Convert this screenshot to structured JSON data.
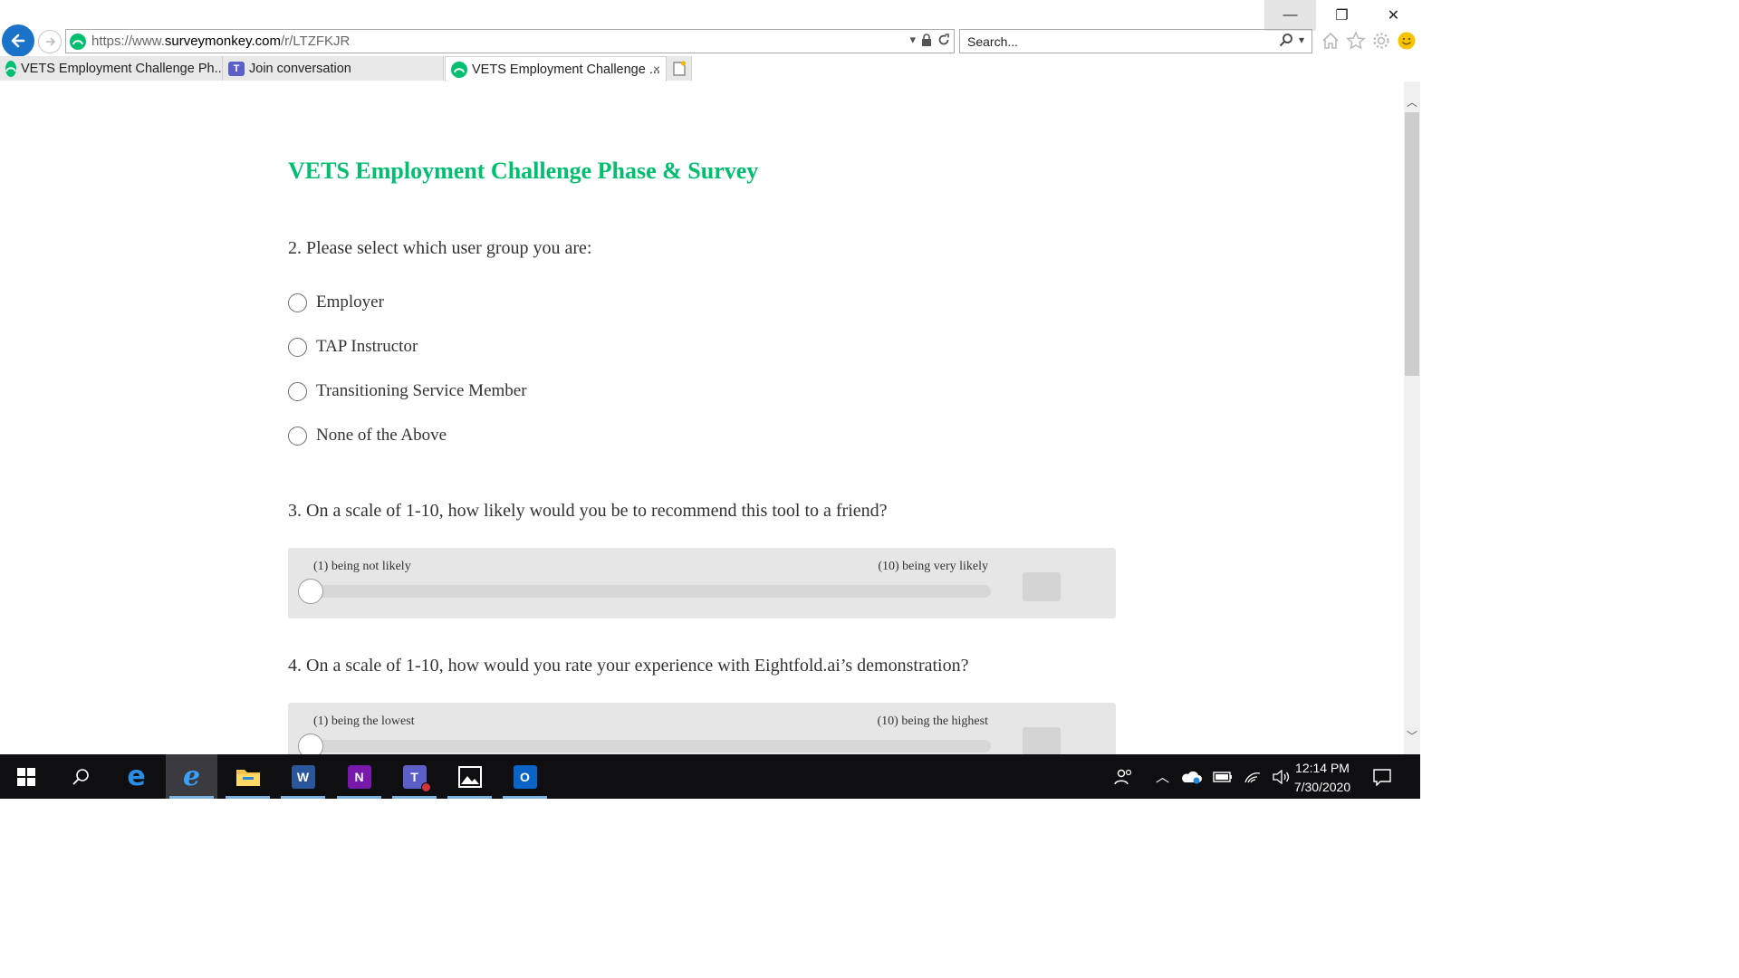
{
  "window": {
    "minimize_glyph": "—",
    "restore_glyph": "❐",
    "close_glyph": "✕"
  },
  "address_bar": {
    "url_scheme": "https://",
    "url_sub": "www.",
    "url_host": "surveymonkey.com",
    "url_path": "/r/LTZFKJR"
  },
  "search": {
    "placeholder": "Search..."
  },
  "tabs": [
    {
      "label": "VETS Employment Challenge Ph...",
      "icon": "surveymonkey-icon",
      "active": false
    },
    {
      "label": "Join conversation",
      "icon": "teams-icon",
      "active": false
    },
    {
      "label": "VETS Employment Challenge ...",
      "icon": "surveymonkey-icon",
      "active": true,
      "close": "×"
    }
  ],
  "survey": {
    "title": "VETS Employment Challenge Phase & Survey",
    "q2": {
      "text": "2. Please select which user group you are:",
      "options": [
        "Employer",
        "TAP Instructor",
        "Transitioning Service Member",
        "None of the Above"
      ]
    },
    "q3": {
      "text": "3. On a scale of 1-10, how likely would you be to recommend this tool to a friend?",
      "low_label": "(1) being not likely",
      "high_label": "(10) being very likely"
    },
    "q4": {
      "text": "4. On a scale of 1-10, how would you rate your experience with Eightfold.ai’s demonstration?",
      "low_label": "(1) being the lowest",
      "high_label": "(10) being the highest"
    }
  },
  "taskbar": {
    "apps": [
      "windows-start",
      "search",
      "edge",
      "internet-explorer",
      "file-explorer",
      "word",
      "onenote",
      "teams",
      "photos",
      "outlook"
    ],
    "active_app": "internet-explorer",
    "time": "12:14 PM",
    "date": "7/30/2020"
  },
  "colors": {
    "brand_green": "#00bf6f",
    "ie_blue": "#1a73c9",
    "taskbar": "#0f0f12"
  }
}
